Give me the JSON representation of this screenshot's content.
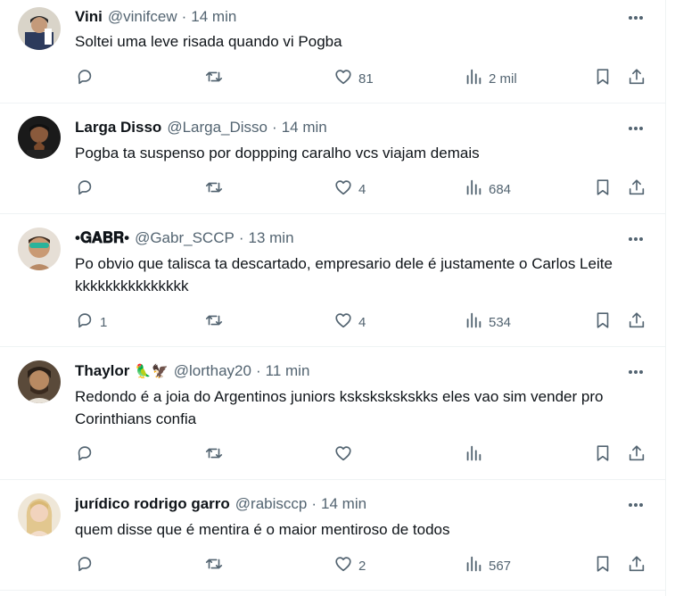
{
  "tweets": [
    {
      "name": "Vini",
      "handle": "@vinifcew",
      "time": "14 min",
      "text": "Soltei uma leve risada quando vi Pogba",
      "replies": "",
      "retweets": "",
      "likes": "81",
      "views": "2 mil"
    },
    {
      "name": "Larga Disso",
      "handle": "@Larga_Disso",
      "time": "14 min",
      "text": "Pogba ta suspenso por doppping caralho vcs viajam demais",
      "replies": "",
      "retweets": "",
      "likes": "4",
      "views": "684"
    },
    {
      "name": "•𝐆𝐀𝐁𝐑•",
      "handle": "@Gabr_SCCP",
      "time": "13 min",
      "text": "Po obvio que talisca ta descartado, empresario dele é justamente o Carlos Leite kkkkkkkkkkkkkkk",
      "replies": "1",
      "retweets": "",
      "likes": "4",
      "views": "534"
    },
    {
      "name": "Thaylor",
      "emoji": "🦜🦅",
      "handle": "@lorthay20",
      "time": "11 min",
      "text": "Redondo é a joia do Argentinos juniors kskskskskskks eles vao sim vender pro Corinthians confia",
      "replies": "",
      "retweets": "",
      "likes": "",
      "views": ""
    },
    {
      "name": "jurídico rodrigo garro",
      "handle": "@rabisccp",
      "time": "14 min",
      "text": "quem disse que é mentira é o maior mentiroso de todos",
      "replies": "",
      "retweets": "",
      "likes": "2",
      "views": "567"
    }
  ],
  "separator": "·",
  "icons": {
    "more": "more-horizontal-icon",
    "reply": "reply-icon",
    "retweet": "retweet-icon",
    "like": "like-icon",
    "views": "views-icon",
    "bookmark": "bookmark-icon",
    "share": "share-icon"
  },
  "colors": {
    "text": "#0f1419",
    "secondary": "#536471",
    "border": "#eff3f4"
  }
}
